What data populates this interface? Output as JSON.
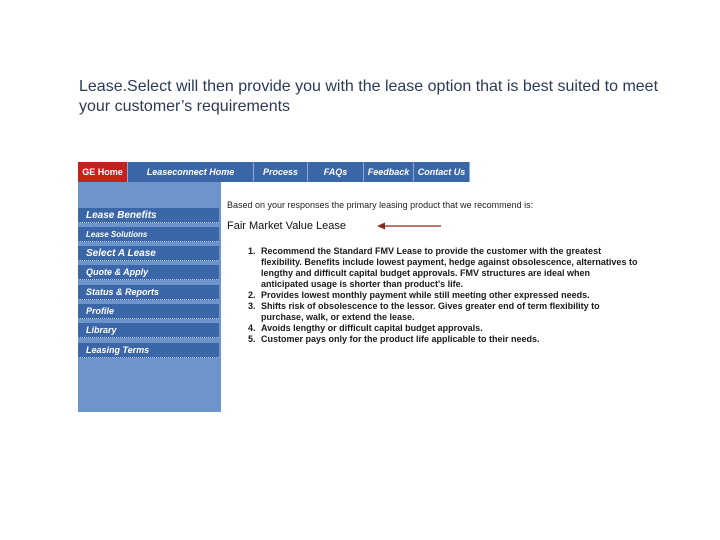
{
  "caption": "Lease.Select will then provide you with the lease option that is best suited to meet your customer’s requirements",
  "topnav": {
    "items": [
      "GE Home",
      "Leaseconnect  Home",
      "Process",
      "FAQs",
      "Feedback",
      "Contact Us"
    ]
  },
  "sidebar": {
    "items": [
      "Lease Benefits",
      "Lease Solutions",
      "Select A Lease",
      "Quote & Apply",
      "Status & Reports",
      "Profile",
      "Library",
      "Leasing Terms"
    ]
  },
  "content": {
    "intro": "Based on your responses the primary leasing product that we recommend is:",
    "recommendation": "Fair Market Value Lease",
    "reasons": [
      "Recommend the Standard FMV Lease to provide the customer with the greatest flexibility. Benefits include lowest payment, hedge against obsolescence, alternatives to lengthy and difficult capital budget approvals. FMV structures are ideal when anticipated usage is shorter than product's life.",
      "Provides lowest monthly payment while still meeting other expressed needs.",
      "Shifts risk of obsolescence to the lessor. Gives greater end of term flexibility to purchase, walk, or extend the lease.",
      "Avoids lengthy or difficult capital budget approvals.",
      "Customer pays only for the product life applicable to their needs."
    ]
  },
  "colors": {
    "nav_blue": "#3b67a8",
    "sidebar_bg": "#6d95cb",
    "ge_red": "#c8201f",
    "arrow": "#8b2a1a"
  }
}
